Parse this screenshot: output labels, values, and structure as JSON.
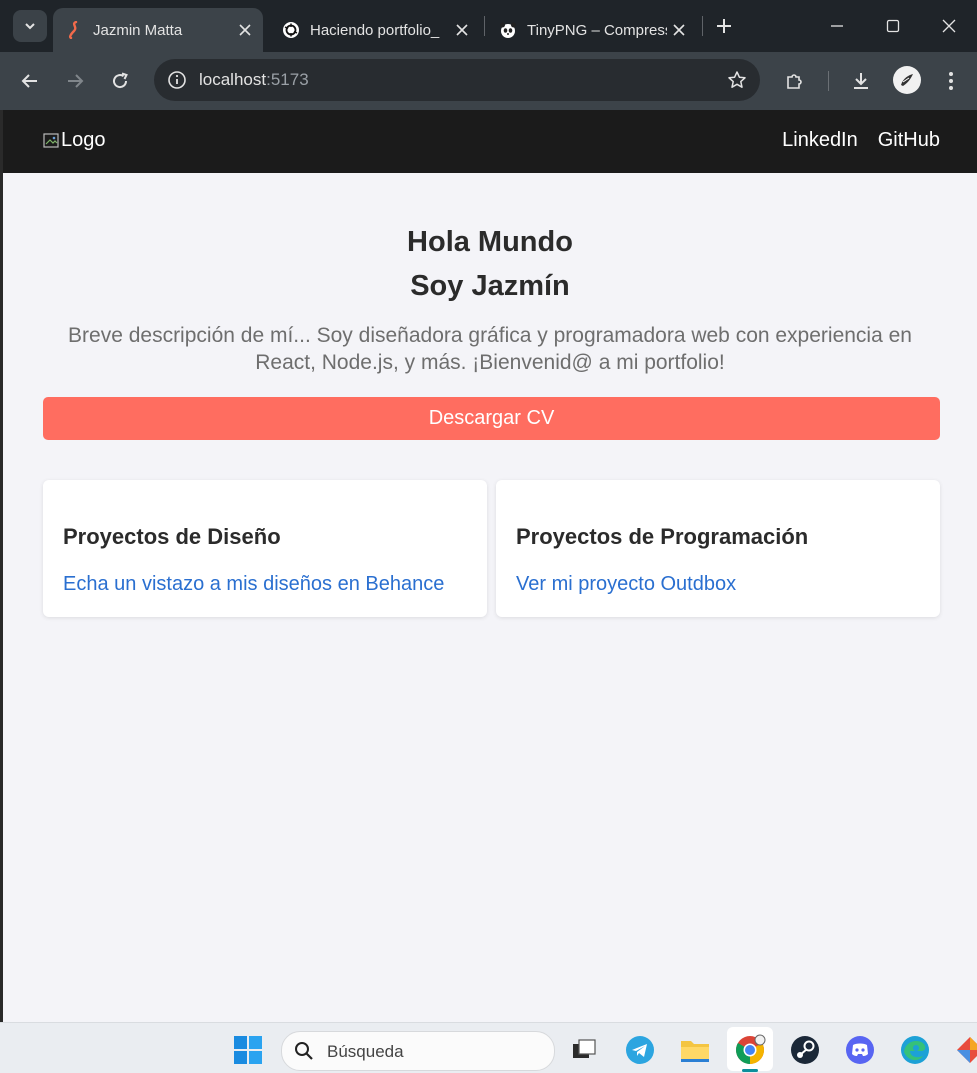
{
  "browser": {
    "tabs": [
      {
        "title": "Jazmin Matta",
        "favicon": "j-logo-icon",
        "active": true
      },
      {
        "title": "Haciendo portfolio_",
        "favicon": "openai-icon",
        "active": false
      },
      {
        "title": "TinyPNG – Compress",
        "favicon": "panda-icon",
        "active": false
      }
    ],
    "url_host": "localhost",
    "url_port": ":5173"
  },
  "site": {
    "logo_alt": "Logo",
    "nav": [
      "LinkedIn",
      "GitHub"
    ],
    "hero": {
      "line1": "Hola Mundo",
      "line2": "Soy Jazmín",
      "description": "Breve descripción de mí... Soy diseñadora gráfica y programadora web con experiencia en React, Node.js, y más. ¡Bienvenid@ a mi portfolio!"
    },
    "cv_button": "Descargar CV",
    "cards": [
      {
        "title": "Proyectos de Diseño",
        "link": "Echa un vistazo a mis diseños en Behance"
      },
      {
        "title": "Proyectos de Programación",
        "link": "Ver mi proyecto Outdbox"
      }
    ]
  },
  "taskbar": {
    "search_placeholder": "Búsqueda"
  },
  "colors": {
    "accent_button": "#ff6d60",
    "link": "#2a6fd0",
    "header_bg": "#1b1b1b",
    "page_bg": "#f4f4f8"
  }
}
